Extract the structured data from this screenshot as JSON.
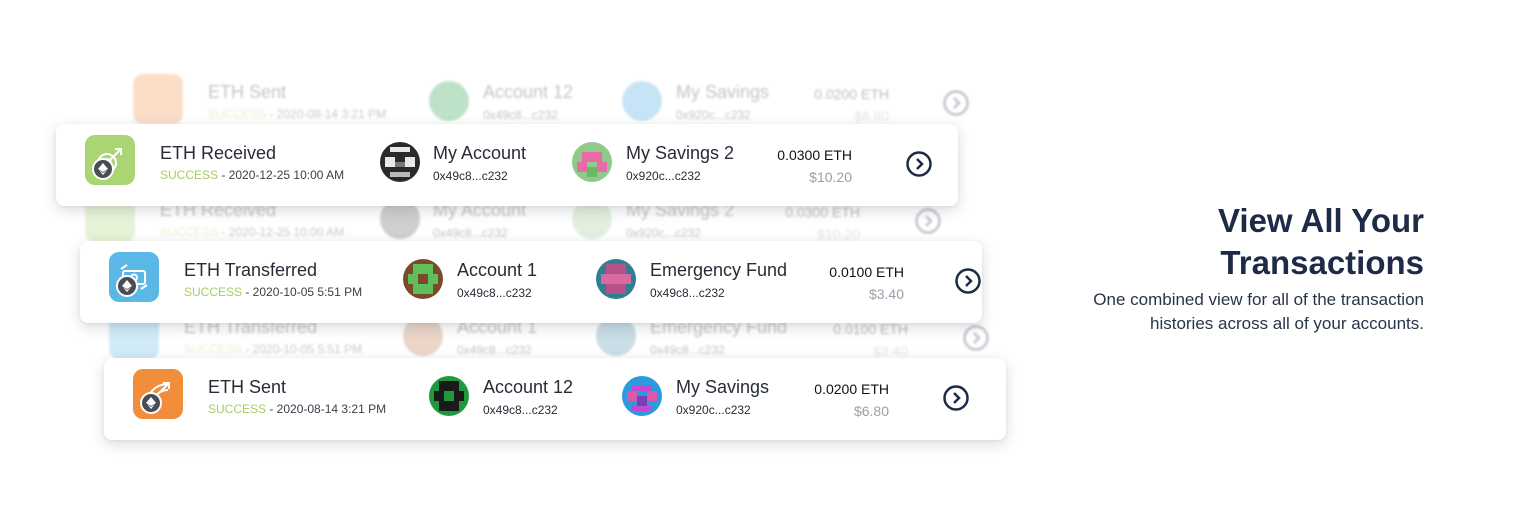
{
  "colors": {
    "received_tile": "#a9d572",
    "transferred_tile": "#5bb7e6",
    "sent_tile": "#f28d3c",
    "success": "#a5cd63",
    "heading": "#1e2b48"
  },
  "hero": {
    "title_line1": "View All Your",
    "title_line2": "Transactions",
    "description": "One combined view for all of the transaction histories across all of your accounts."
  },
  "transactions": [
    {
      "icon": "eth-received-icon",
      "type": "ETH Received",
      "status": "SUCCESS",
      "date": " - 2020-12-25 10:00 AM",
      "from_name": "My Account",
      "from_address": "0x49c8...c232",
      "to_name": "My Savings 2",
      "to_address": "0x920c...c232",
      "amount": "0.0300 ETH",
      "usd": "$10.20"
    },
    {
      "icon": "eth-transferred-icon",
      "type": "ETH Transferred",
      "status": "SUCCESS",
      "date": " - 2020-10-05 5:51 PM",
      "from_name": "Account 1",
      "from_address": "0x49c8...c232",
      "to_name": "Emergency Fund",
      "to_address": "0x49c8...c232",
      "amount": "0.0100 ETH",
      "usd": "$3.40"
    },
    {
      "icon": "eth-sent-icon",
      "type": "ETH Sent",
      "status": "SUCCESS",
      "date": " - 2020-08-14 3:21 PM",
      "from_name": "Account 12",
      "from_address": "0x49c8...c232",
      "to_name": "My Savings",
      "to_address": "0x920c...c232",
      "amount": "0.0200 ETH",
      "usd": "$6.80"
    }
  ]
}
